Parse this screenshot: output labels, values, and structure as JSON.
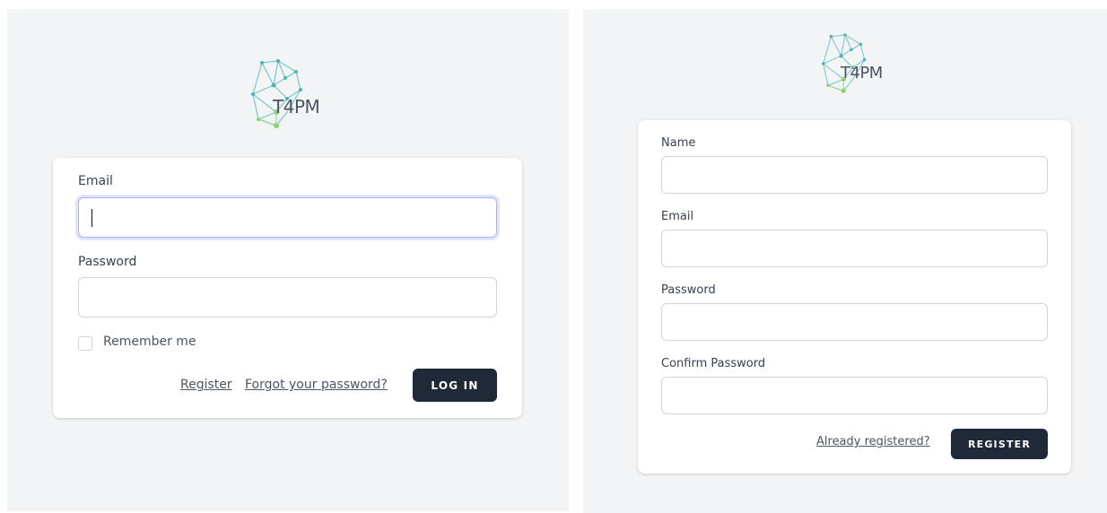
{
  "login": {
    "logo": {
      "icon": "network-brain-icon",
      "text": "T4PM"
    },
    "email_label": "Email",
    "email_value": "",
    "password_label": "Password",
    "password_value": "",
    "remember_label": "Remember me",
    "remember_checked": false,
    "register_link": "Register",
    "forgot_link": "Forgot your password?",
    "login_button": "LOG IN"
  },
  "register": {
    "logo": {
      "icon": "network-brain-icon",
      "text": "T4PM"
    },
    "name_label": "Name",
    "email_label": "Email",
    "password_label": "Password",
    "confirm_label": "Confirm Password",
    "already_link": "Already registered?",
    "register_button": "REGISTER"
  },
  "colors": {
    "page_bg": "#f3f4f6",
    "button_bg": "#1f2937",
    "focus_ring": "#a5b4fc",
    "logo_teal": "#5fbfbf",
    "logo_green": "#8fd17a"
  }
}
